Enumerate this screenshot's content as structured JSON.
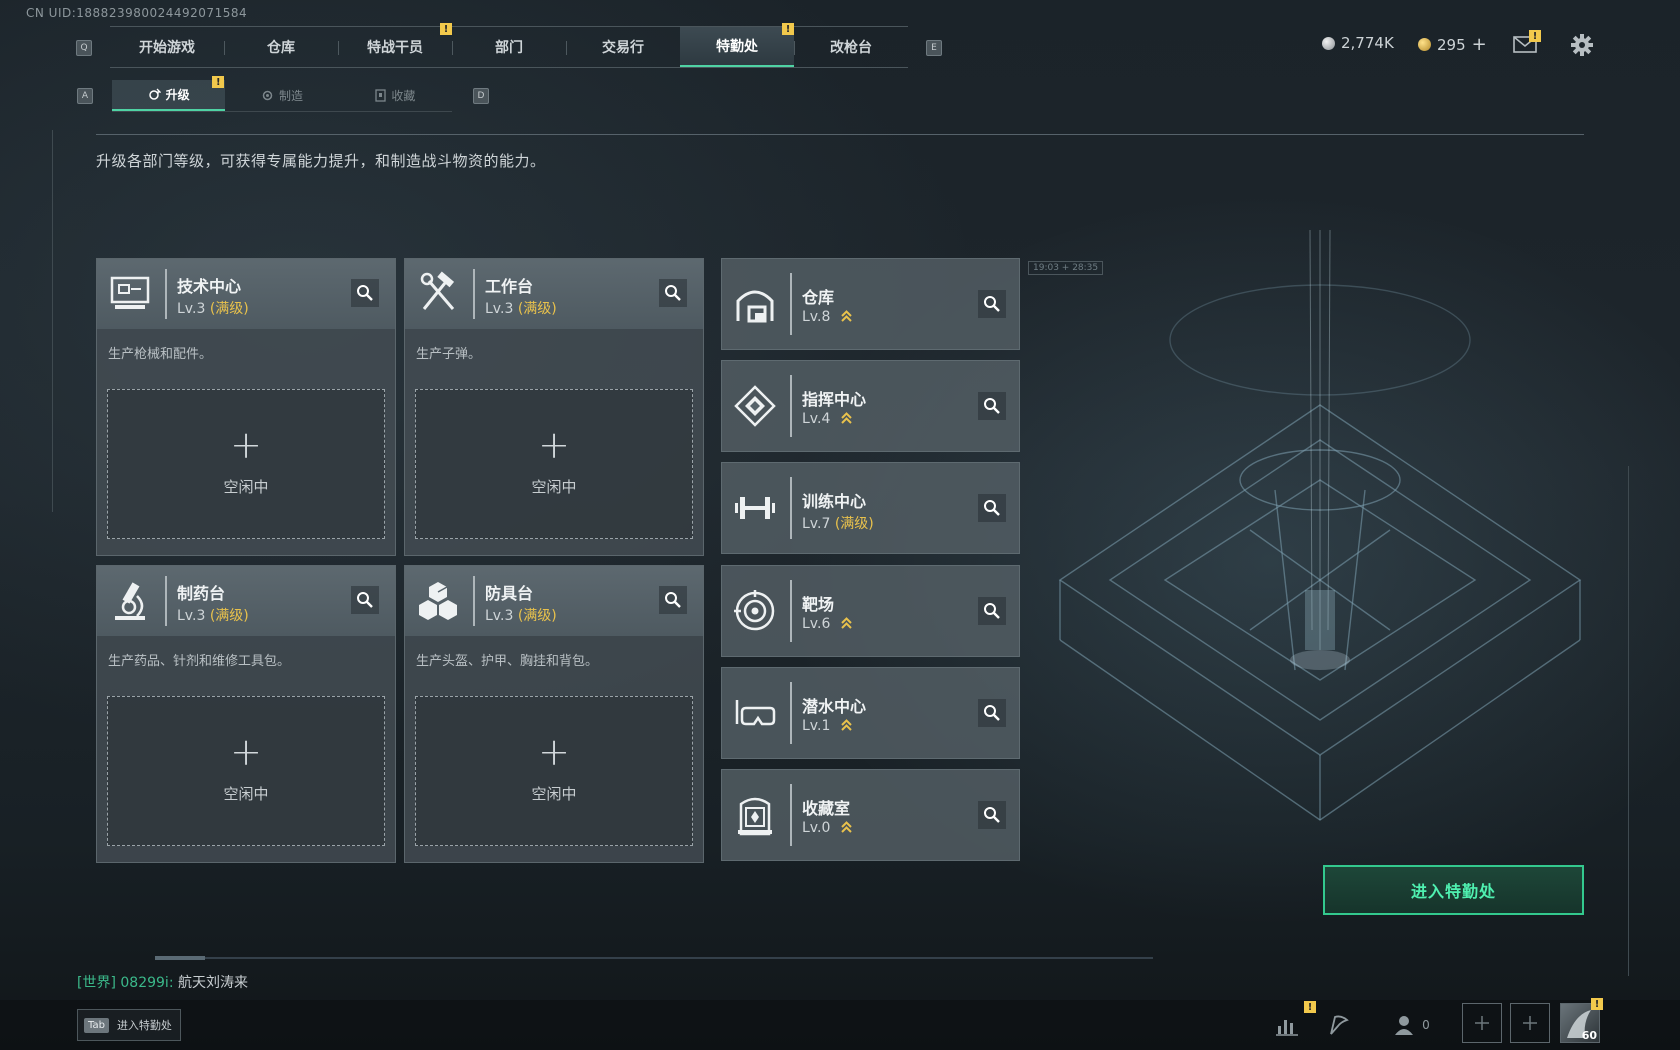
{
  "uid_text": "CN UID:1888239800244920715​84",
  "top_nav": {
    "left_key": "Q",
    "right_key": "E",
    "tabs": [
      {
        "label": "开始游戏",
        "badge": ""
      },
      {
        "label": "仓库",
        "badge": ""
      },
      {
        "label": "特战干员",
        "badge": "!"
      },
      {
        "label": "部门",
        "badge": ""
      },
      {
        "label": "交易行",
        "badge": ""
      },
      {
        "label": "特勤处",
        "badge": "!",
        "active": true
      },
      {
        "label": "改枪台",
        "badge": ""
      }
    ]
  },
  "currency": {
    "silver": "2,774K",
    "gold": "295",
    "gold_add": "+"
  },
  "mail_badge": "!",
  "sub_nav": {
    "left_key": "A",
    "right_key": "D",
    "tabs": [
      {
        "label": "升级",
        "icon": "gear-up-icon",
        "badge": "!",
        "active": true
      },
      {
        "label": "制造",
        "icon": "craft-icon",
        "badge": ""
      },
      {
        "label": "收藏",
        "icon": "trophy-icon",
        "badge": ""
      }
    ]
  },
  "description": "升级各部门等级，可获得专属能力提升，和制造战斗物资的能力。",
  "production_cards": [
    {
      "name": "技术中心",
      "level": "Lv.3",
      "max_label": "(满级)",
      "desc": "生产枪械和配件。",
      "slot_plus": "+",
      "slot_label": "空闲中",
      "icon": "computer-icon"
    },
    {
      "name": "工作台",
      "level": "Lv.3",
      "max_label": "(满级)",
      "desc": "生产子弹。",
      "slot_plus": "+",
      "slot_label": "空闲中",
      "icon": "tools-icon"
    },
    {
      "name": "制药台",
      "level": "Lv.3",
      "max_label": "(满级)",
      "desc": "生产药品、针剂和维修工具包。",
      "slot_plus": "+",
      "slot_label": "空闲中",
      "icon": "microscope-icon"
    },
    {
      "name": "防具台",
      "level": "Lv.3",
      "max_label": "(满级)",
      "desc": "生产头盔、护甲、胸挂和背包。",
      "slot_plus": "+",
      "slot_label": "空闲中",
      "icon": "armor-blocks-icon"
    }
  ],
  "departments": [
    {
      "name": "仓库",
      "level": "Lv.8",
      "max_label": "",
      "upgradable": true,
      "icon": "warehouse-icon"
    },
    {
      "name": "指挥中心",
      "level": "Lv.4",
      "max_label": "",
      "upgradable": true,
      "icon": "command-icon"
    },
    {
      "name": "训练中心",
      "level": "Lv.7",
      "max_label": "(满级)",
      "upgradable": false,
      "icon": "dumbbell-icon"
    },
    {
      "name": "靶场",
      "level": "Lv.6",
      "max_label": "",
      "upgradable": true,
      "icon": "target-icon"
    },
    {
      "name": "潜水中心",
      "level": "Lv.1",
      "max_label": "",
      "upgradable": true,
      "icon": "dive-mask-icon"
    },
    {
      "name": "收藏室",
      "level": "Lv.0",
      "max_label": "",
      "upgradable": true,
      "icon": "showcase-icon"
    }
  ],
  "scene_label": "19:03 + 28:35",
  "enter_button": "进入特勤处",
  "chat": {
    "channel": "[世界]",
    "user": "08299i",
    "separator": ":",
    "message": "航天刘涛来"
  },
  "bottom": {
    "tab_key": "Tab",
    "tab_label": "进入特勤处",
    "friends_count": "0",
    "stats_badge": "!",
    "avatar_badge": "!",
    "avatar_level": "60"
  },
  "colors": {
    "accent": "#4fd3a4",
    "max_level": "#e9c24c",
    "badge": "#f2c94c",
    "enter_text": "#4ff0b0"
  }
}
